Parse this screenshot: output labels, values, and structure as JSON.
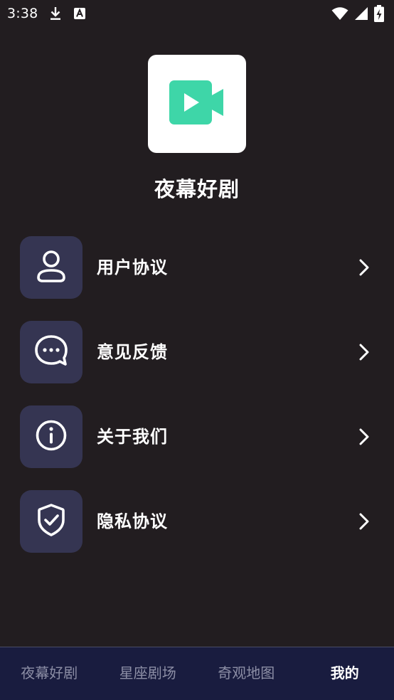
{
  "status_bar": {
    "time": "3:38",
    "icons": [
      "download-icon",
      "font-a-icon",
      "wifi-icon",
      "signal-icon",
      "battery-charging-icon"
    ]
  },
  "app": {
    "name": "夜幕好剧",
    "logo_icon": "video-camera-icon",
    "logo_color": "#3ed6a8"
  },
  "menu": {
    "items": [
      {
        "label": "用户协议",
        "icon": "user-icon"
      },
      {
        "label": "意见反馈",
        "icon": "chat-bubble-icon"
      },
      {
        "label": "关于我们",
        "icon": "info-icon"
      },
      {
        "label": "隐私协议",
        "icon": "shield-check-icon"
      }
    ],
    "icon_box_color": "#353552"
  },
  "bottom_nav": {
    "tabs": [
      {
        "label": "夜幕好剧"
      },
      {
        "label": "星座剧场"
      },
      {
        "label": "奇观地图"
      },
      {
        "label": "我的"
      }
    ],
    "active_index": 3
  }
}
